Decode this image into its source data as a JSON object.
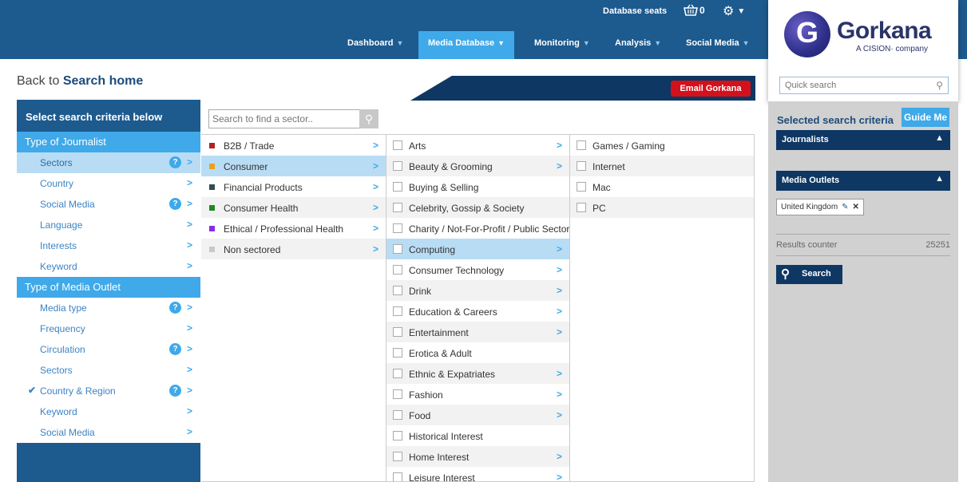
{
  "header": {
    "database_seats": "Database seats",
    "basket_count": "0",
    "nav": [
      {
        "label": "Dashboard",
        "active": false
      },
      {
        "label": "Media Database",
        "active": true
      },
      {
        "label": "Monitoring",
        "active": false
      },
      {
        "label": "Analysis",
        "active": false
      },
      {
        "label": "Social Media",
        "active": false
      }
    ]
  },
  "logo": {
    "name": "Gorkana",
    "tagline": "A CISION· company"
  },
  "quick_search": {
    "placeholder": "Quick search"
  },
  "back": {
    "prefix": "Back to",
    "target": "Search home"
  },
  "email_button": "Email Gorkana",
  "left_panel": {
    "heading": "Select search criteria below",
    "journalist_section": "Type of Journalist",
    "journalist_items": [
      {
        "label": "Sectors",
        "help": "?"
      },
      {
        "label": "Country"
      },
      {
        "label": "Social Media",
        "help": "?"
      },
      {
        "label": "Language"
      },
      {
        "label": "Interests"
      },
      {
        "label": "Keyword"
      }
    ],
    "outlet_section": "Type of Media Outlet",
    "outlet_items": [
      {
        "label": "Media type",
        "help": "?"
      },
      {
        "label": "Frequency"
      },
      {
        "label": "Circulation",
        "help": "?"
      },
      {
        "label": "Sectors"
      },
      {
        "label": "Country & Region",
        "help": "?",
        "checked": true
      },
      {
        "label": "Keyword"
      },
      {
        "label": "Social Media"
      }
    ]
  },
  "sector_search": {
    "placeholder": "Search to find a sector.."
  },
  "sectors": [
    {
      "label": "B2B / Trade",
      "color": "#b22222"
    },
    {
      "label": "Consumer",
      "color": "#e8a317",
      "selected": true
    },
    {
      "label": "Financial Products",
      "color": "#2f4f4f"
    },
    {
      "label": "Consumer Health",
      "color": "#1e8a1e"
    },
    {
      "label": "Ethical / Professional Health",
      "color": "#8a2be2"
    },
    {
      "label": "Non sectored",
      "color": "#c8c8c8"
    }
  ],
  "subsectors": [
    {
      "label": "Arts",
      "arrow": true
    },
    {
      "label": "Beauty & Grooming",
      "arrow": true
    },
    {
      "label": "Buying & Selling",
      "arrow": false
    },
    {
      "label": "Celebrity, Gossip & Society",
      "arrow": false
    },
    {
      "label": "Charity / Not-For-Profit / Public Sector",
      "arrow": false
    },
    {
      "label": "Computing",
      "arrow": true,
      "selected": true
    },
    {
      "label": "Consumer Technology",
      "arrow": true
    },
    {
      "label": "Drink",
      "arrow": true
    },
    {
      "label": "Education & Careers",
      "arrow": true
    },
    {
      "label": "Entertainment",
      "arrow": true
    },
    {
      "label": "Erotica & Adult",
      "arrow": false
    },
    {
      "label": "Ethnic & Expatriates",
      "arrow": true
    },
    {
      "label": "Fashion",
      "arrow": true
    },
    {
      "label": "Food",
      "arrow": true
    },
    {
      "label": "Historical Interest",
      "arrow": false
    },
    {
      "label": "Home Interest",
      "arrow": true
    },
    {
      "label": "Leisure Interest",
      "arrow": true
    }
  ],
  "topics": [
    {
      "label": "Games / Gaming"
    },
    {
      "label": "Internet"
    },
    {
      "label": "Mac"
    },
    {
      "label": "PC"
    }
  ],
  "right_panel": {
    "title": "Selected search criteria",
    "guide_button": "Guide Me",
    "journalists_bar": "Journalists",
    "outlets_bar": "Media Outlets",
    "tag": "United Kingdom",
    "counter_label": "Results counter",
    "counter_value": "25251",
    "search_button": "Search"
  }
}
